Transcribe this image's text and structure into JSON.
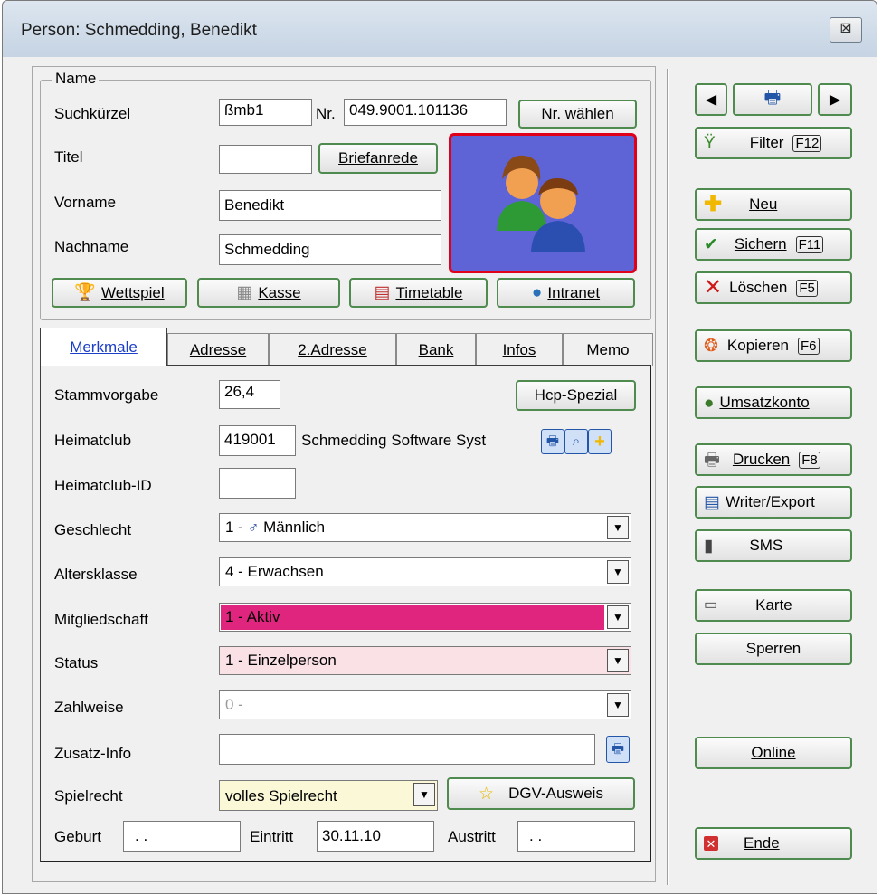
{
  "window": {
    "title": "Person: Schmedding, Benedikt",
    "close_glyph": "⊠"
  },
  "name_group": {
    "legend": "Name",
    "suchkuerzel_label": "Suchkürzel",
    "suchkuerzel_value": "ßmb1",
    "nr_label": "Nr.",
    "nr_value": "049.9001.101136",
    "nr_waehlen": "Nr. wählen",
    "titel_label": "Titel",
    "titel_value": "",
    "briefanrede": "Briefanrede",
    "vorname_label": "Vorname",
    "vorname_value": "Benedikt",
    "nachname_label": "Nachname",
    "nachname_value": "Schmedding",
    "buttons": [
      "Wettspiel",
      "Kasse",
      "Timetable",
      "Intranet"
    ]
  },
  "tabs": [
    "Merkmale",
    "Adresse",
    "2.Adresse",
    "Bank",
    "Infos",
    "Memo"
  ],
  "merkmale": {
    "stammvorgabe_label": "Stammvorgabe",
    "stammvorgabe_value": "26,4",
    "hcp_spezial": "Hcp-Spezial",
    "heimatclub_label": "Heimatclub",
    "heimatclub_nr": "419001",
    "heimatclub_name": "Schmedding Software Syst",
    "heimatclub_id_label": "Heimatclub-ID",
    "heimatclub_id_value": "",
    "geschlecht_label": "Geschlecht",
    "geschlecht_prefix": "1 -",
    "geschlecht_value": "Männlich",
    "altersklasse_label": "Altersklasse",
    "altersklasse_value": "4 - Erwachsen",
    "mitgliedschaft_label": "Mitgliedschaft",
    "mitgliedschaft_value": "1 - Aktiv",
    "status_label": "Status",
    "status_value": "1 - Einzelperson",
    "zahlweise_label": "Zahlweise",
    "zahlweise_value": "0 -",
    "zusatz_label": "Zusatz-Info",
    "zusatz_value": "",
    "spielrecht_label": "Spielrecht",
    "spielrecht_value": "volles Spielrecht",
    "dgv_ausweis": "DGV-Ausweis",
    "geburt_label": "Geburt",
    "geburt_value": ". .",
    "eintritt_label": "Eintritt",
    "eintritt_value": "30.11.10",
    "austritt_label": "Austritt",
    "austritt_value": ". ."
  },
  "side": {
    "filter": "Filter",
    "filter_key": "F12",
    "neu": "Neu",
    "sichern": "Sichern",
    "sichern_key": "F11",
    "loeschen": "Löschen",
    "loeschen_key": "F5",
    "kopieren": "Kopieren",
    "kopieren_key": "F6",
    "umsatzkonto": "Umsatzkonto",
    "drucken": "Drucken",
    "drucken_key": "F8",
    "writer": "Writer/Export",
    "sms": "SMS",
    "karte": "Karte",
    "sperren": "Sperren",
    "online": "Online",
    "ende": "Ende"
  },
  "colors": {
    "mitgliedschaft_bg": "#e0257f",
    "status_bg": "#f9e1e6",
    "spielrecht_bg": "#fbf8d8",
    "photo_bg": "#5e63d6",
    "photo_border": "#e0001a",
    "button_border": "#4f8a4f"
  }
}
